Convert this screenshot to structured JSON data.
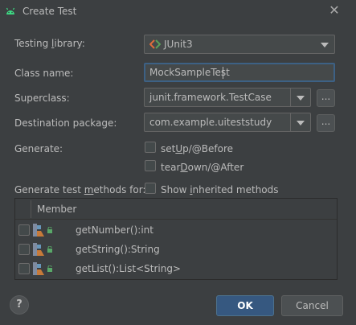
{
  "window": {
    "title": "Create Test",
    "close_icon": "close-icon"
  },
  "colors": {
    "accent": "#365880",
    "focus_border": "#3d6185",
    "background": "#3c3f41",
    "android_green": "#3ddc84"
  },
  "form": {
    "testing_library": {
      "label_pre": "Testing ",
      "label_u": "l",
      "label_post": "ibrary:",
      "value": "JUnit3"
    },
    "class_name": {
      "label": "Class name:",
      "value": "MockSampleTest"
    },
    "superclass": {
      "label": "Superclass:",
      "value": "junit.framework.TestCase",
      "browse": "..."
    },
    "destination_package": {
      "label": "Destination package:",
      "value": "com.example.uiteststudy",
      "browse": "..."
    },
    "generate": {
      "label": "Generate:",
      "setup": {
        "pre": "set",
        "u": "U",
        "post": "p/@Before",
        "checked": false
      },
      "teardown": {
        "pre": "tear",
        "u": "D",
        "post": "own/@After",
        "checked": false
      }
    },
    "methods": {
      "label_pre": "Generate test ",
      "label_u": "m",
      "label_post": "ethods for:",
      "show_inherited": {
        "pre": "Show ",
        "u": "i",
        "post": "nherited methods",
        "checked": false
      }
    }
  },
  "table": {
    "header": "Member",
    "rows": [
      {
        "text": "getNumber():int",
        "checked": false
      },
      {
        "text": "getString():String",
        "checked": false
      },
      {
        "text": "getList():List<String>",
        "checked": false
      }
    ]
  },
  "footer": {
    "help": "?",
    "ok": "OK",
    "cancel": "Cancel"
  }
}
